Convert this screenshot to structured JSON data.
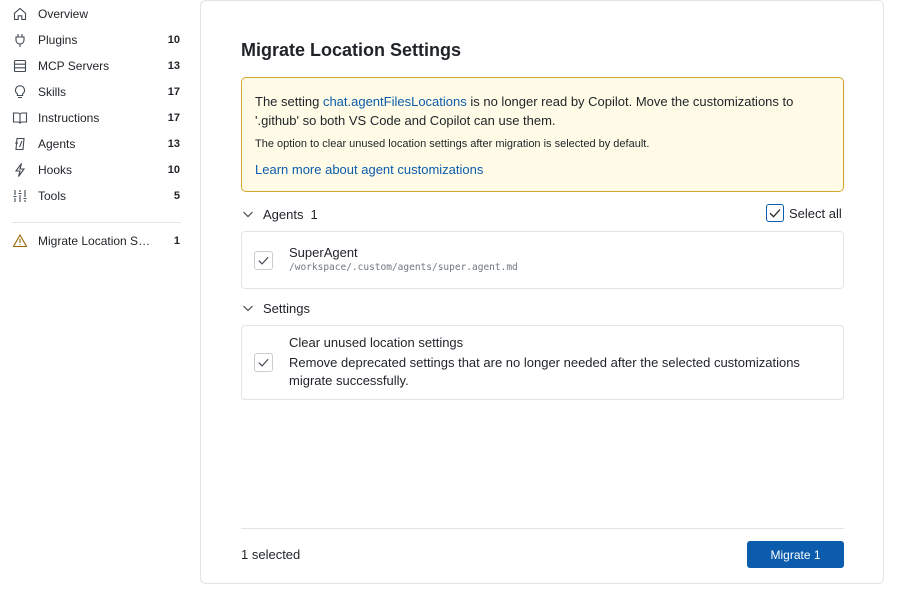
{
  "sidebar": {
    "items": [
      {
        "label": "Overview",
        "count": "",
        "icon": "home-icon"
      },
      {
        "label": "Plugins",
        "count": "10",
        "icon": "plug-icon"
      },
      {
        "label": "MCP Servers",
        "count": "13",
        "icon": "server-icon"
      },
      {
        "label": "Skills",
        "count": "17",
        "icon": "lightbulb-icon"
      },
      {
        "label": "Instructions",
        "count": "17",
        "icon": "book-icon"
      },
      {
        "label": "Agents",
        "count": "13",
        "icon": "agent-icon"
      },
      {
        "label": "Hooks",
        "count": "10",
        "icon": "lightning-icon"
      },
      {
        "label": "Tools",
        "count": "5",
        "icon": "tools-icon"
      }
    ],
    "migrate_item": {
      "label": "Migrate Location Settings",
      "count": "1",
      "icon": "warning-icon"
    }
  },
  "main": {
    "title": "Migrate Location Settings",
    "warning": {
      "text_before": "The setting ",
      "setting_link": "chat.agentFilesLocations",
      "text_after": " is no longer read by Copilot. Move the customizations to '.github' so both VS Code and Copilot can use them.",
      "note": "The option to clear unused location settings after migration is selected by default.",
      "learn_more": "Learn more about agent customizations"
    },
    "agents_section": {
      "label": "Agents",
      "count": "1",
      "select_all": "Select all"
    },
    "agents": [
      {
        "name": "SuperAgent",
        "path": "/workspace/.custom/agents/super.agent.md",
        "checked": true
      }
    ],
    "settings_section": {
      "label": "Settings"
    },
    "settings": [
      {
        "name": "Clear unused location settings",
        "description": "Remove deprecated settings that are no longer needed after the selected customizations migrate successfully.",
        "checked": true
      }
    ],
    "footer": {
      "selected": "1 selected",
      "migrate_button": "Migrate 1"
    }
  },
  "colors": {
    "accent": "#0b5cad",
    "warning_bg": "#fffbe6",
    "warning_border": "#d4a72c"
  }
}
